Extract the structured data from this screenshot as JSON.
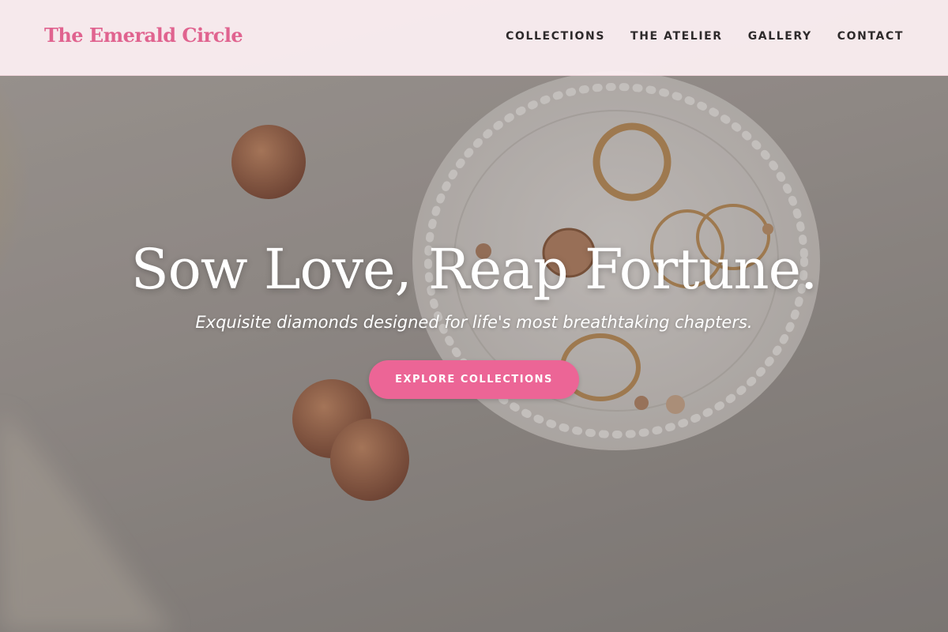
{
  "brand": {
    "name": "The Emerald Circle",
    "color": "#e0638f"
  },
  "nav": {
    "items": [
      {
        "label": "COLLECTIONS"
      },
      {
        "label": "THE ATELIER"
      },
      {
        "label": "GALLERY"
      },
      {
        "label": "CONTACT"
      }
    ]
  },
  "hero": {
    "background_image": "rings-and-earrings-on-white-dish-photo",
    "headline": "Sow Love, Reap Fortune.",
    "subheadline": "Exquisite diamonds designed for life's most breathtaking chapters.",
    "cta_label": "EXPLORE COLLECTIONS",
    "cta_color": "#ec6596"
  }
}
